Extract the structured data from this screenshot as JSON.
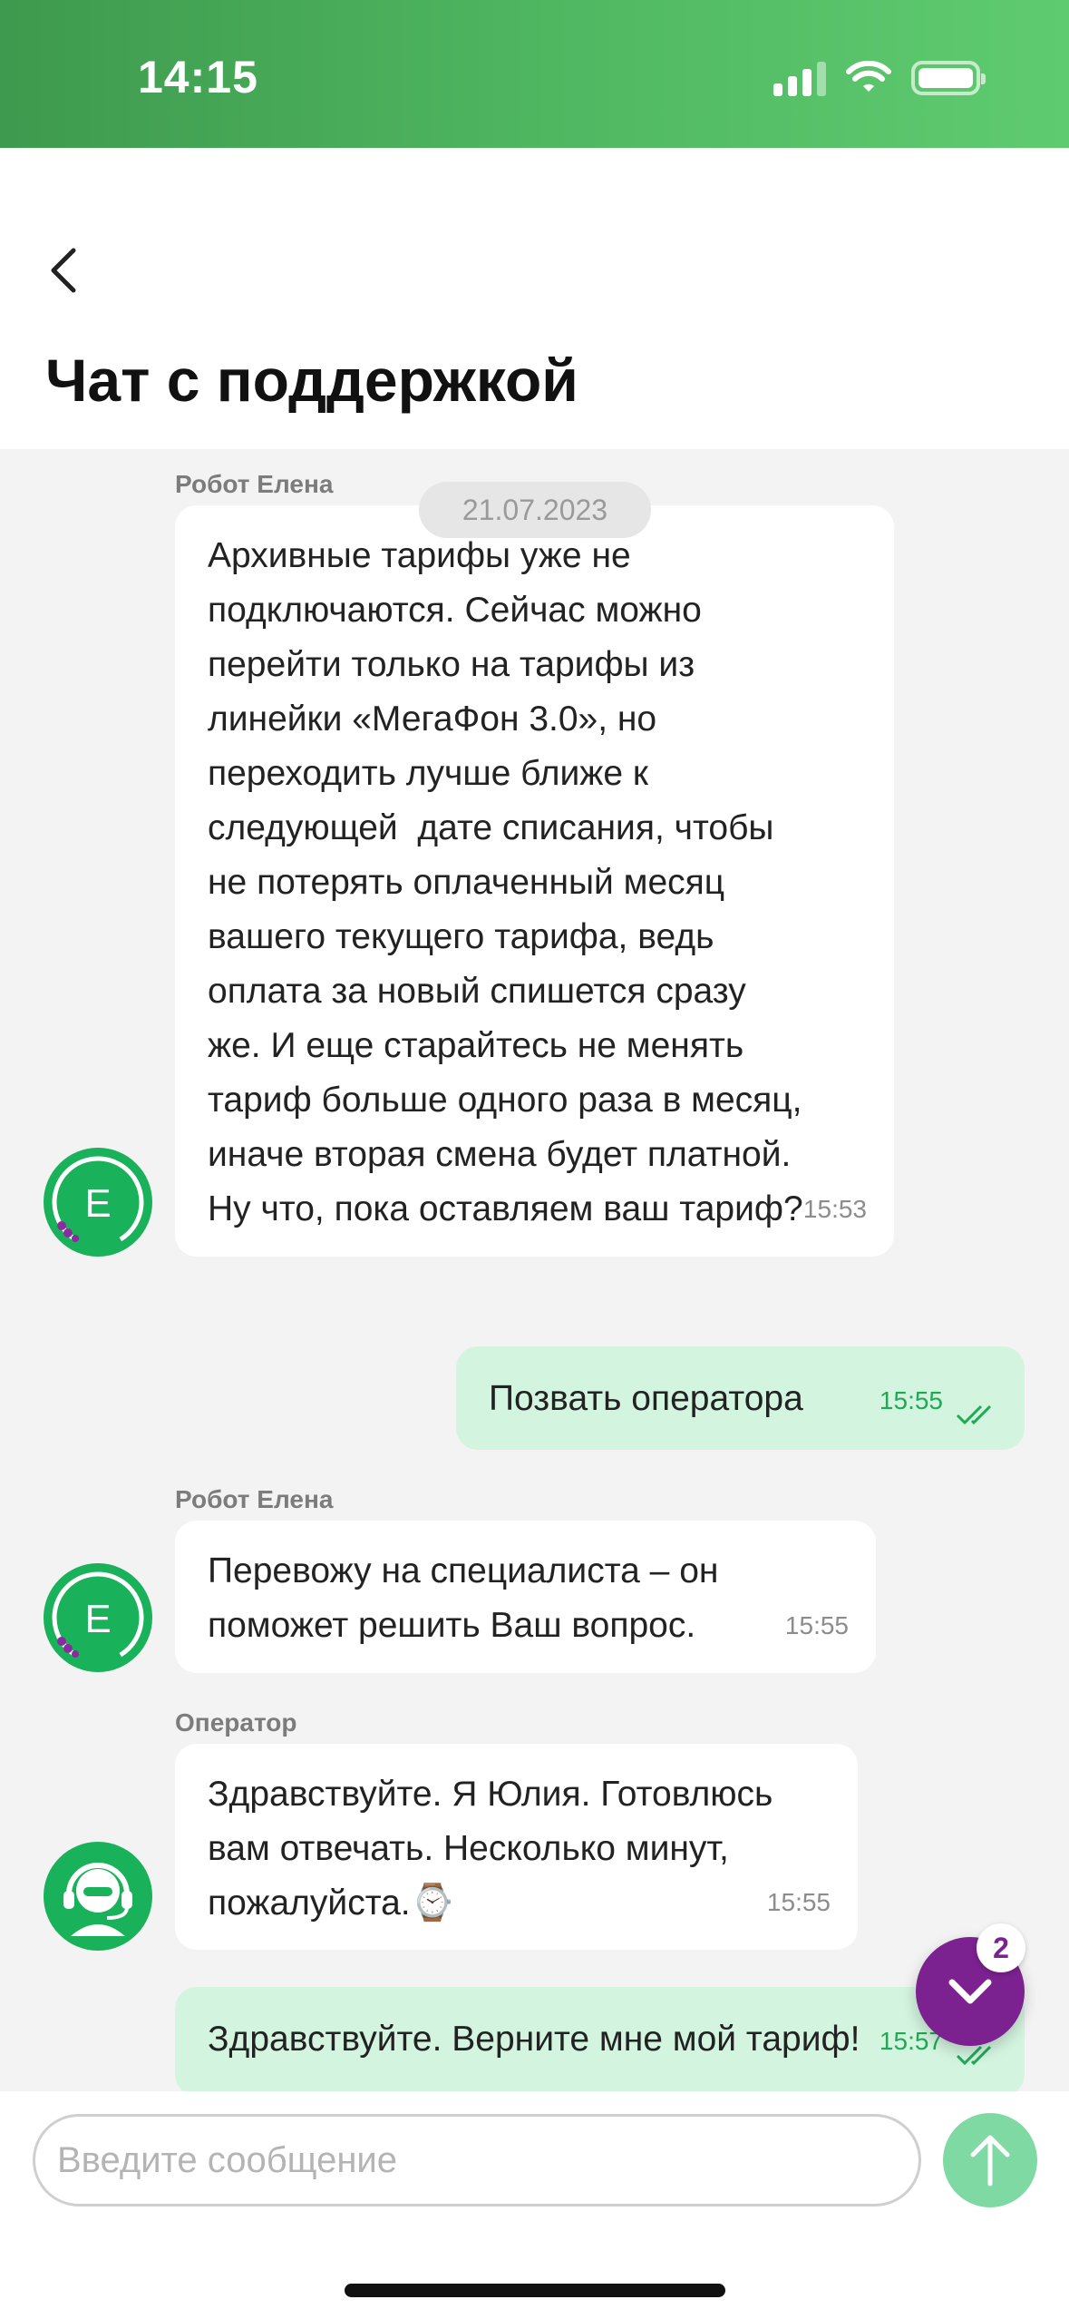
{
  "status_bar": {
    "time": "14:15",
    "icons": [
      "cellular-signal-icon",
      "wifi-icon",
      "battery-icon"
    ]
  },
  "header": {
    "back_icon": "chevron-left-icon",
    "title": "Чат с поддержкой"
  },
  "chat": {
    "date_badge": "21.07.2023",
    "messages": [
      {
        "direction": "incoming",
        "sender": "Робот Елена",
        "avatar": "robot-elena-avatar-icon",
        "text": "Архивные тарифы уже не\nподключаются. Сейчас можно\nперейти только на тарифы из\nлинейки «МегаФон 3.0», но\nпереходить лучше ближе к\nследующей  дате списания, чтобы\nне потерять оплаченный месяц\nвашего текущего тарифа, ведь\nоплата за новый спишется сразу\nже. И еще старайтесь не менять\nтариф больше одного раза в месяц,\nиначе вторая смена будет платной.\nНу что, пока оставляем ваш тариф?",
        "time": "15:53"
      },
      {
        "direction": "outgoing",
        "text": "Позвать оператора",
        "time": "15:55",
        "status": "read"
      },
      {
        "direction": "incoming",
        "sender": "Робот Елена",
        "avatar": "robot-elena-avatar-icon",
        "text": "Перевожу на специалиста – он\nпоможет решить Ваш вопрос.",
        "time": "15:55"
      },
      {
        "direction": "incoming",
        "sender": "Оператор",
        "avatar": "operator-headset-avatar-icon",
        "text": "Здравствуйте. Я Юлия. Готовлюсь\nвам отвечать. Несколько минут,\nпожалуйста.⌚",
        "time": "15:55"
      },
      {
        "direction": "outgoing",
        "text": "Здравствуйте. Верните мне мой тариф!",
        "time": "15:57",
        "status": "read"
      }
    ]
  },
  "scroll_button": {
    "icon": "chevron-down-icon",
    "badge": "2"
  },
  "composer": {
    "placeholder": "Введите сообщение",
    "value": "",
    "send_icon": "arrow-up-icon"
  },
  "colors": {
    "brand_green": "#19b15a",
    "status_bar_green": "#4fb862",
    "outgoing_bubble": "#d3f4df",
    "accent_purple": "#7b2190",
    "send_button": "#7fd9a2"
  }
}
